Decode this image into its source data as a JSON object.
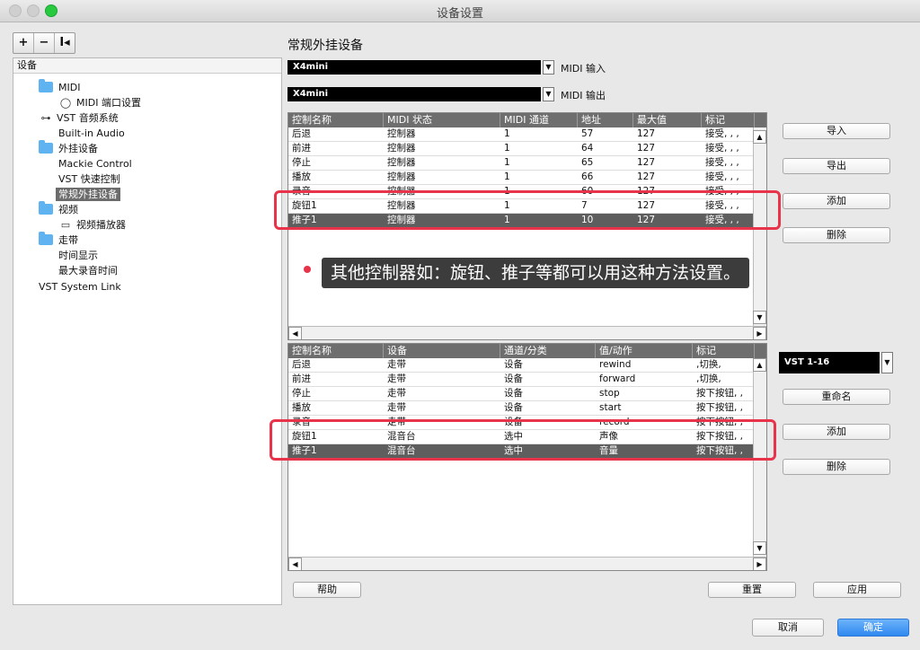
{
  "window": {
    "title": "设备设置"
  },
  "toolbar": {
    "add": "+",
    "remove": "−",
    "reset": "I◂"
  },
  "sidebar": {
    "header": "设备",
    "items": [
      {
        "label": "MIDI",
        "icon": "folder-icon"
      },
      {
        "label": "MIDI 端口设置",
        "icon": "midi-port-icon"
      },
      {
        "label": "VST 音频系统",
        "icon": "audio-system-icon"
      },
      {
        "label": "Built-in Audio"
      },
      {
        "label": "外挂设备",
        "icon": "folder-icon"
      },
      {
        "label": "Mackie Control"
      },
      {
        "label": "VST 快速控制"
      },
      {
        "label": "常规外挂设备"
      },
      {
        "label": "视频",
        "icon": "folder-icon"
      },
      {
        "label": "视频播放器",
        "icon": "video-player-icon"
      },
      {
        "label": "走带",
        "icon": "folder-icon"
      },
      {
        "label": "时间显示"
      },
      {
        "label": "最大录音时间"
      },
      {
        "label": "VST System Link"
      }
    ]
  },
  "main": {
    "title": "常规外挂设备",
    "midi_in": {
      "value": "X4mini",
      "label": "MIDI 输入"
    },
    "midi_out": {
      "value": "X4mini",
      "label": "MIDI 输出"
    }
  },
  "upper_table": {
    "headers": [
      "控制名称",
      "MIDI 状态",
      "MIDI 通道",
      "地址",
      "最大值",
      "标记"
    ],
    "rows": [
      [
        "后退",
        "控制器",
        "1",
        "57",
        "127",
        "接受, , ,"
      ],
      [
        "前进",
        "控制器",
        "1",
        "64",
        "127",
        "接受, , ,"
      ],
      [
        "停止",
        "控制器",
        "1",
        "65",
        "127",
        "接受, , ,"
      ],
      [
        "播放",
        "控制器",
        "1",
        "66",
        "127",
        "接受, , ,"
      ],
      [
        "录音",
        "控制器",
        "1",
        "60",
        "127",
        "接受, , ,"
      ],
      [
        "旋钮1",
        "控制器",
        "1",
        "7",
        "127",
        "接受, , ,"
      ],
      [
        "推子1",
        "控制器",
        "1",
        "10",
        "127",
        "接受, , ,"
      ]
    ]
  },
  "lower_table": {
    "headers": [
      "控制名称",
      "设备",
      "通道/分类",
      "值/动作",
      "标记"
    ],
    "rows": [
      [
        "后退",
        "走带",
        "设备",
        "rewind",
        ",切换,"
      ],
      [
        "前进",
        "走带",
        "设备",
        "forward",
        ",切换,"
      ],
      [
        "停止",
        "走带",
        "设备",
        "stop",
        "按下按钮, ,"
      ],
      [
        "播放",
        "走带",
        "设备",
        "start",
        "按下按钮, ,"
      ],
      [
        "录音",
        "走带",
        "设备",
        "record",
        "按下按钮, ,"
      ],
      [
        "旋钮1",
        "混音台",
        "选中",
        "声像",
        "按下按钮, ,"
      ],
      [
        "推子1",
        "混音台",
        "选中",
        "音量",
        "按下按钮, ,"
      ]
    ]
  },
  "buttons": {
    "import": "导入",
    "export": "导出",
    "add_upper": "添加",
    "delete_upper": "删除",
    "bank": "VST 1-16",
    "rename": "重命名",
    "add_lower": "添加",
    "delete_lower": "删除",
    "help": "帮助",
    "reset": "重置",
    "apply": "应用",
    "cancel": "取消",
    "ok": "确定"
  },
  "annotation": {
    "text": "其他控制器如：旋钮、推子等都可以用这种方法设置。"
  },
  "colors": {
    "highlight": "#e8334a",
    "selected_row": "#5e5e5e",
    "primary": "#2f88f0"
  }
}
